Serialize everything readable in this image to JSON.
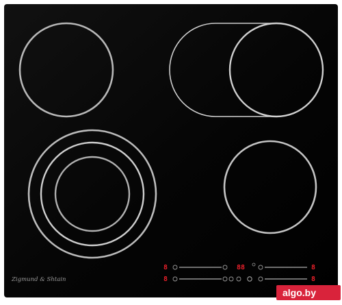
{
  "product": {
    "brand": "Zigmund & Shtain",
    "surface_color": "#050505",
    "ring_color": "#c8c8c8",
    "display_color": "#e8202a"
  },
  "zones": [
    {
      "id": "front-left-dual",
      "shape": "dual-circle"
    },
    {
      "id": "rear-left",
      "shape": "circle"
    },
    {
      "id": "rear-right-oval",
      "shape": "oval-extension"
    },
    {
      "id": "front-right",
      "shape": "circle"
    }
  ],
  "controls": {
    "top_row": {
      "left_display": "8",
      "timer_display": "88",
      "right_display": "8"
    },
    "bottom_row": {
      "left_display": "8",
      "right_display": "8"
    }
  },
  "watermark": {
    "text": "algo.by",
    "color": "#d9233b"
  }
}
